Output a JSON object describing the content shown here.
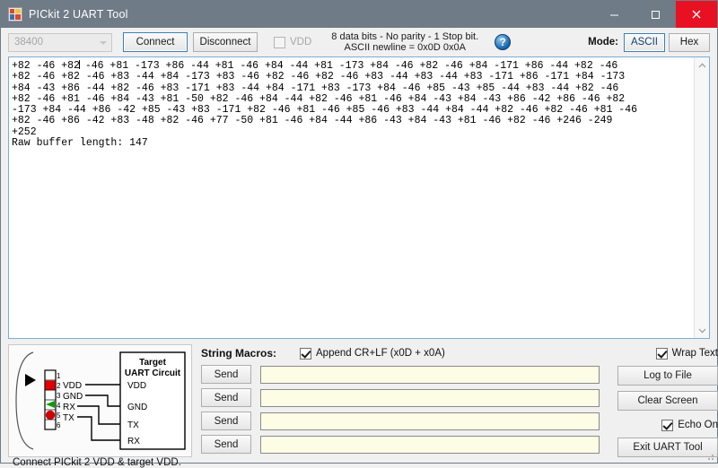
{
  "window": {
    "title": "PICkit 2 UART Tool",
    "minimize_label": "–",
    "maximize_label": "□",
    "close_label": "×"
  },
  "toolbar": {
    "baud_rate": "38400",
    "connect_label": "Connect",
    "disconnect_label": "Disconnect",
    "vdd_label": "VDD",
    "vdd_checked": false,
    "serial_info_line1": "8 data bits - No parity - 1 Stop bit.",
    "serial_info_line2": "ASCII newline = 0x0D 0x0A",
    "help_label": "?",
    "mode_label": "Mode:",
    "mode_ascii": "ASCII",
    "mode_hex": "Hex",
    "mode_selected": "ASCII"
  },
  "terminal": {
    "lines": [
      "+82 -46 +82 -46 +81 -173 +86 -44 +81 -46 +84 -44 +81 -173 +84 -46 +82 -46 +84 -171 +86 -44 +82 -46",
      "+82 -46 +82 -46 +83 -44 +84 -173 +83 -46 +82 -46 +82 -46 +83 -44 +83 -44 +83 -171 +86 -171 +84 -173",
      "+84 -43 +86 -44 +82 -46 +83 -171 +83 -44 +84 -171 +83 -173 +84 -46 +85 -43 +85 -44 +83 -44 +82 -46",
      "+82 -46 +81 -46 +84 -43 +81 -50 +82 -46 +84 -44 +82 -46 +81 -46 +84 -43 +84 -43 +86 -42 +86 -46 +82",
      "-173 +84 -44 +86 -42 +85 -43 +83 -171 +82 -46 +81 -46 +85 -46 +83 -44 +84 -44 +82 -46 +82 -46 +81 -46",
      "+82 -46 +86 -42 +83 -48 +82 -46 +77 -50 +81 -46 +84 -44 +86 -43 +84 -43 +81 -46 +82 -46 +246 -249",
      "+252",
      "Raw buffer length: 147"
    ],
    "caret_after_line": 0,
    "caret_after_chars": 11,
    "scroll_up_icon": "chevron-up",
    "scroll_down_icon": "chevron-down"
  },
  "diagram": {
    "target_title_line1": "Target",
    "target_title_line2": "UART Circuit",
    "pin_numbers": [
      "1",
      "2",
      "3",
      "4",
      "5",
      "6"
    ],
    "left_labels": [
      "VDD",
      "GND",
      "RX",
      "TX"
    ],
    "right_labels": [
      "VDD",
      "GND",
      "TX",
      "RX"
    ],
    "caption": "Connect PICkit 2 VDD & target VDD.",
    "pin_colors": [
      "#ffffff",
      "#e00000",
      "#ffffff",
      "#00a000",
      "#d00000",
      "#ffffff"
    ]
  },
  "macros": {
    "title": "String Macros:",
    "append_label": "Append CR+LF (x0D + x0A)",
    "append_checked": true,
    "send_label": "Send",
    "rows": [
      {
        "send_label": "Send",
        "value": "",
        "placeholder": ""
      },
      {
        "send_label": "Send",
        "value": "",
        "placeholder": ""
      },
      {
        "send_label": "Send",
        "value": "",
        "placeholder": ""
      },
      {
        "send_label": "Send",
        "value": "",
        "placeholder": ""
      }
    ]
  },
  "right_panel": {
    "wrap_text_label": "Wrap Text",
    "wrap_text_checked": true,
    "log_to_file_label": "Log to File",
    "clear_screen_label": "Clear Screen",
    "echo_on_label": "Echo On",
    "echo_on_checked": true,
    "exit_label": "Exit UART Tool"
  },
  "colors": {
    "titlebar": "#6f7b86",
    "close_button": "#e81123",
    "accent_border": "#3c7fb1",
    "input_background": "#fdfde6",
    "terminal_background": "#ffffff"
  }
}
